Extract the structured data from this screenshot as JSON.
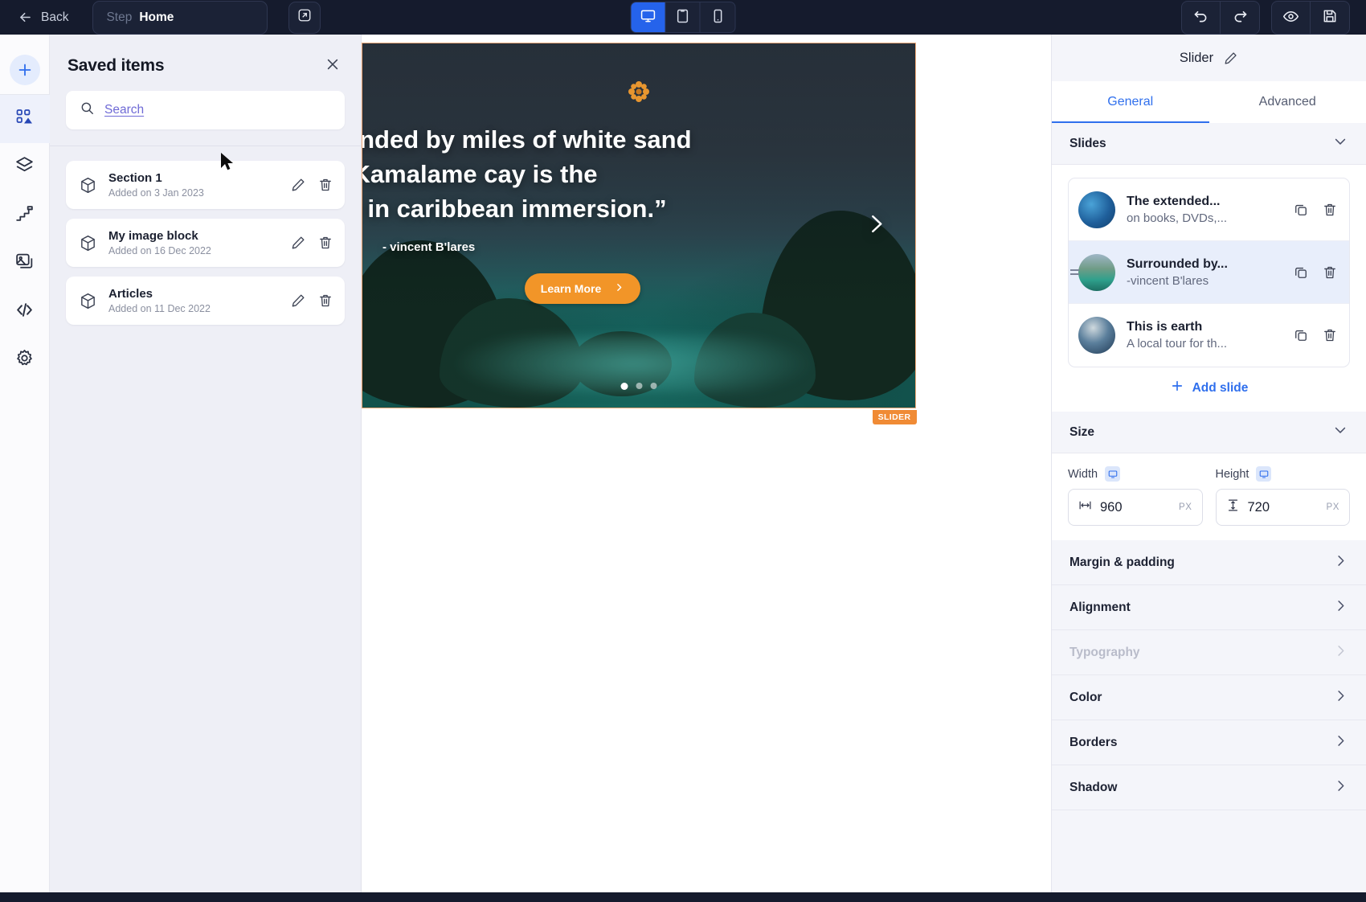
{
  "topbar": {
    "back_label": "Back",
    "step_label": "Step",
    "step_value": "Home",
    "open_external_icon": "external-link-icon",
    "devices": [
      {
        "name": "desktop",
        "icon": "desktop-icon",
        "active": true
      },
      {
        "name": "tablet",
        "icon": "tablet-icon",
        "active": false
      },
      {
        "name": "mobile",
        "icon": "mobile-icon",
        "active": false
      }
    ],
    "actions": [
      {
        "name": "undo",
        "icon": "undo-icon"
      },
      {
        "name": "redo",
        "icon": "redo-icon"
      },
      {
        "name": "preview",
        "icon": "eye-icon"
      },
      {
        "name": "save",
        "icon": "save-icon"
      }
    ]
  },
  "rail": {
    "items": [
      {
        "name": "add",
        "icon": "plus-icon",
        "active": false
      },
      {
        "name": "saved-items",
        "icon": "blocks-icon",
        "active": true
      },
      {
        "name": "layers",
        "icon": "layers-icon",
        "active": false
      },
      {
        "name": "steps",
        "icon": "stairs-icon",
        "active": false
      },
      {
        "name": "media",
        "icon": "image-icon",
        "active": false
      },
      {
        "name": "code",
        "icon": "code-icon",
        "active": false
      },
      {
        "name": "settings",
        "icon": "gear-icon",
        "active": false
      }
    ]
  },
  "panel": {
    "title": "Saved items",
    "close_icon": "close-icon",
    "search": {
      "placeholder": "Search",
      "value": "",
      "icon": "search-icon"
    },
    "items": [
      {
        "name": "Section 1",
        "meta": "Added on 3 Jan 2023",
        "icon": "cube-icon"
      },
      {
        "name": "My image block",
        "meta": "Added on 16 Dec 2022",
        "icon": "cube-icon"
      },
      {
        "name": "Articles",
        "meta": "Added on 11 Dec 2022",
        "icon": "cube-icon"
      }
    ],
    "row_actions": [
      {
        "name": "edit",
        "icon": "pencil-icon"
      },
      {
        "name": "delete",
        "icon": "trash-icon"
      }
    ]
  },
  "canvas": {
    "selection_tag": "SLIDER",
    "selection_color": "#f08b35",
    "slide": {
      "quote": "“Surrounded by miles of white sand\nbeach; Kamalame cay is the\nultimate in caribbean immersion.”",
      "author": "- vincent B'lares",
      "cta_label": "Learn More",
      "cta_color": "#f29528",
      "cta_icon": "chevron-right-icon",
      "ornament_icon": "flower-icon",
      "next_icon": "chevron-right-icon",
      "dots": 3,
      "active_dot": 1
    }
  },
  "inspector": {
    "title": "Slider",
    "edit_icon": "pencil-icon",
    "tabs": [
      {
        "label": "General",
        "active": true
      },
      {
        "label": "Advanced",
        "active": false
      }
    ],
    "slides_section": {
      "title": "Slides",
      "chevron_icon": "chevron-down-icon",
      "slides": [
        {
          "title": "The extended...",
          "subtitle": "on books, DVDs,...",
          "selected": false
        },
        {
          "title": "Surrounded by...",
          "subtitle": "-vincent B'lares",
          "selected": true
        },
        {
          "title": "This is earth",
          "subtitle": "A local tour for th...",
          "selected": false
        }
      ],
      "row_actions": [
        {
          "name": "duplicate",
          "icon": "copy-icon"
        },
        {
          "name": "delete",
          "icon": "trash-icon"
        }
      ],
      "add_label": "Add slide",
      "add_icon": "plus-icon"
    },
    "size_section": {
      "title": "Size",
      "chevron_icon": "chevron-down-icon",
      "width": {
        "label": "Width",
        "value": "960",
        "unit": "PX",
        "icon": "width-icon",
        "badge": "desktop-icon"
      },
      "height": {
        "label": "Height",
        "value": "720",
        "unit": "PX",
        "icon": "height-icon",
        "badge": "desktop-icon"
      }
    },
    "accordions": [
      {
        "label": "Margin & padding",
        "disabled": false,
        "icon": "chevron-right-icon"
      },
      {
        "label": "Alignment",
        "disabled": false,
        "icon": "chevron-right-icon"
      },
      {
        "label": "Typography",
        "disabled": true,
        "icon": "chevron-right-icon"
      },
      {
        "label": "Color",
        "disabled": false,
        "icon": "chevron-right-icon"
      },
      {
        "label": "Borders",
        "disabled": false,
        "icon": "chevron-right-icon"
      },
      {
        "label": "Shadow",
        "disabled": false,
        "icon": "chevron-right-icon"
      }
    ]
  },
  "colors": {
    "topbar_bg": "#151b2d",
    "accent_blue": "#2f6fed",
    "device_active": "#2563eb",
    "selection_orange": "#f08b35",
    "cta_orange": "#f29528"
  }
}
